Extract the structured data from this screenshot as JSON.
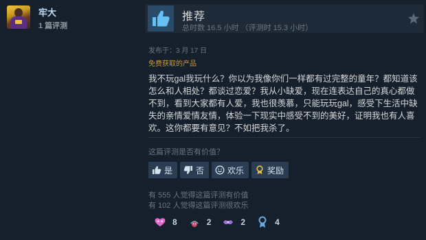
{
  "user": {
    "name": "牢大",
    "review_count": "1 篇评测"
  },
  "review": {
    "verdict": "推荐",
    "hours": "总时数 16.5 小时 （评测时 15.3 小时）",
    "posted": "发布于：3 月 17 日",
    "acquired": "免费获取的产品",
    "text": "我不玩gal我玩什么？你以为我像你们一样都有过完整的童年？都知道该怎么和人相处？都谈过恋爱？我从小缺爱，现在连表达自己的真心都做不到，看到大家都有人爱，我也很羡慕，只能玩玩gal，感受下生活中缺失的亲情爱情友情，体验一下现实中感受不到的美好，证明我也有人喜欢。这你都要有意见？不如把我杀了。"
  },
  "feedback": {
    "question": "这篇评测是否有价值？",
    "buttons": {
      "yes": "是",
      "no": "否",
      "funny": "欢乐",
      "award": "奖励"
    },
    "helpful_stat": "有 555 人觉得这篇评测有价值",
    "funny_stat": "有 102 人觉得这篇评测很欢乐"
  },
  "awards": [
    {
      "icon": "heart-eyes-award-icon",
      "count": "8",
      "color": "#e26bcf"
    },
    {
      "icon": "wholesome-award-icon",
      "count": "2",
      "color": "#4fb3c7"
    },
    {
      "icon": "clap-award-icon",
      "count": "2",
      "color": "#9b6fd8"
    },
    {
      "icon": "medal-award-icon",
      "count": "4",
      "color": "#6aa8e0"
    }
  ],
  "colors": {
    "background": "#16202d",
    "header": "#1e2a38",
    "username": "#c1dbf4",
    "free_product": "#c89b3c",
    "button": "#2a3d53"
  }
}
